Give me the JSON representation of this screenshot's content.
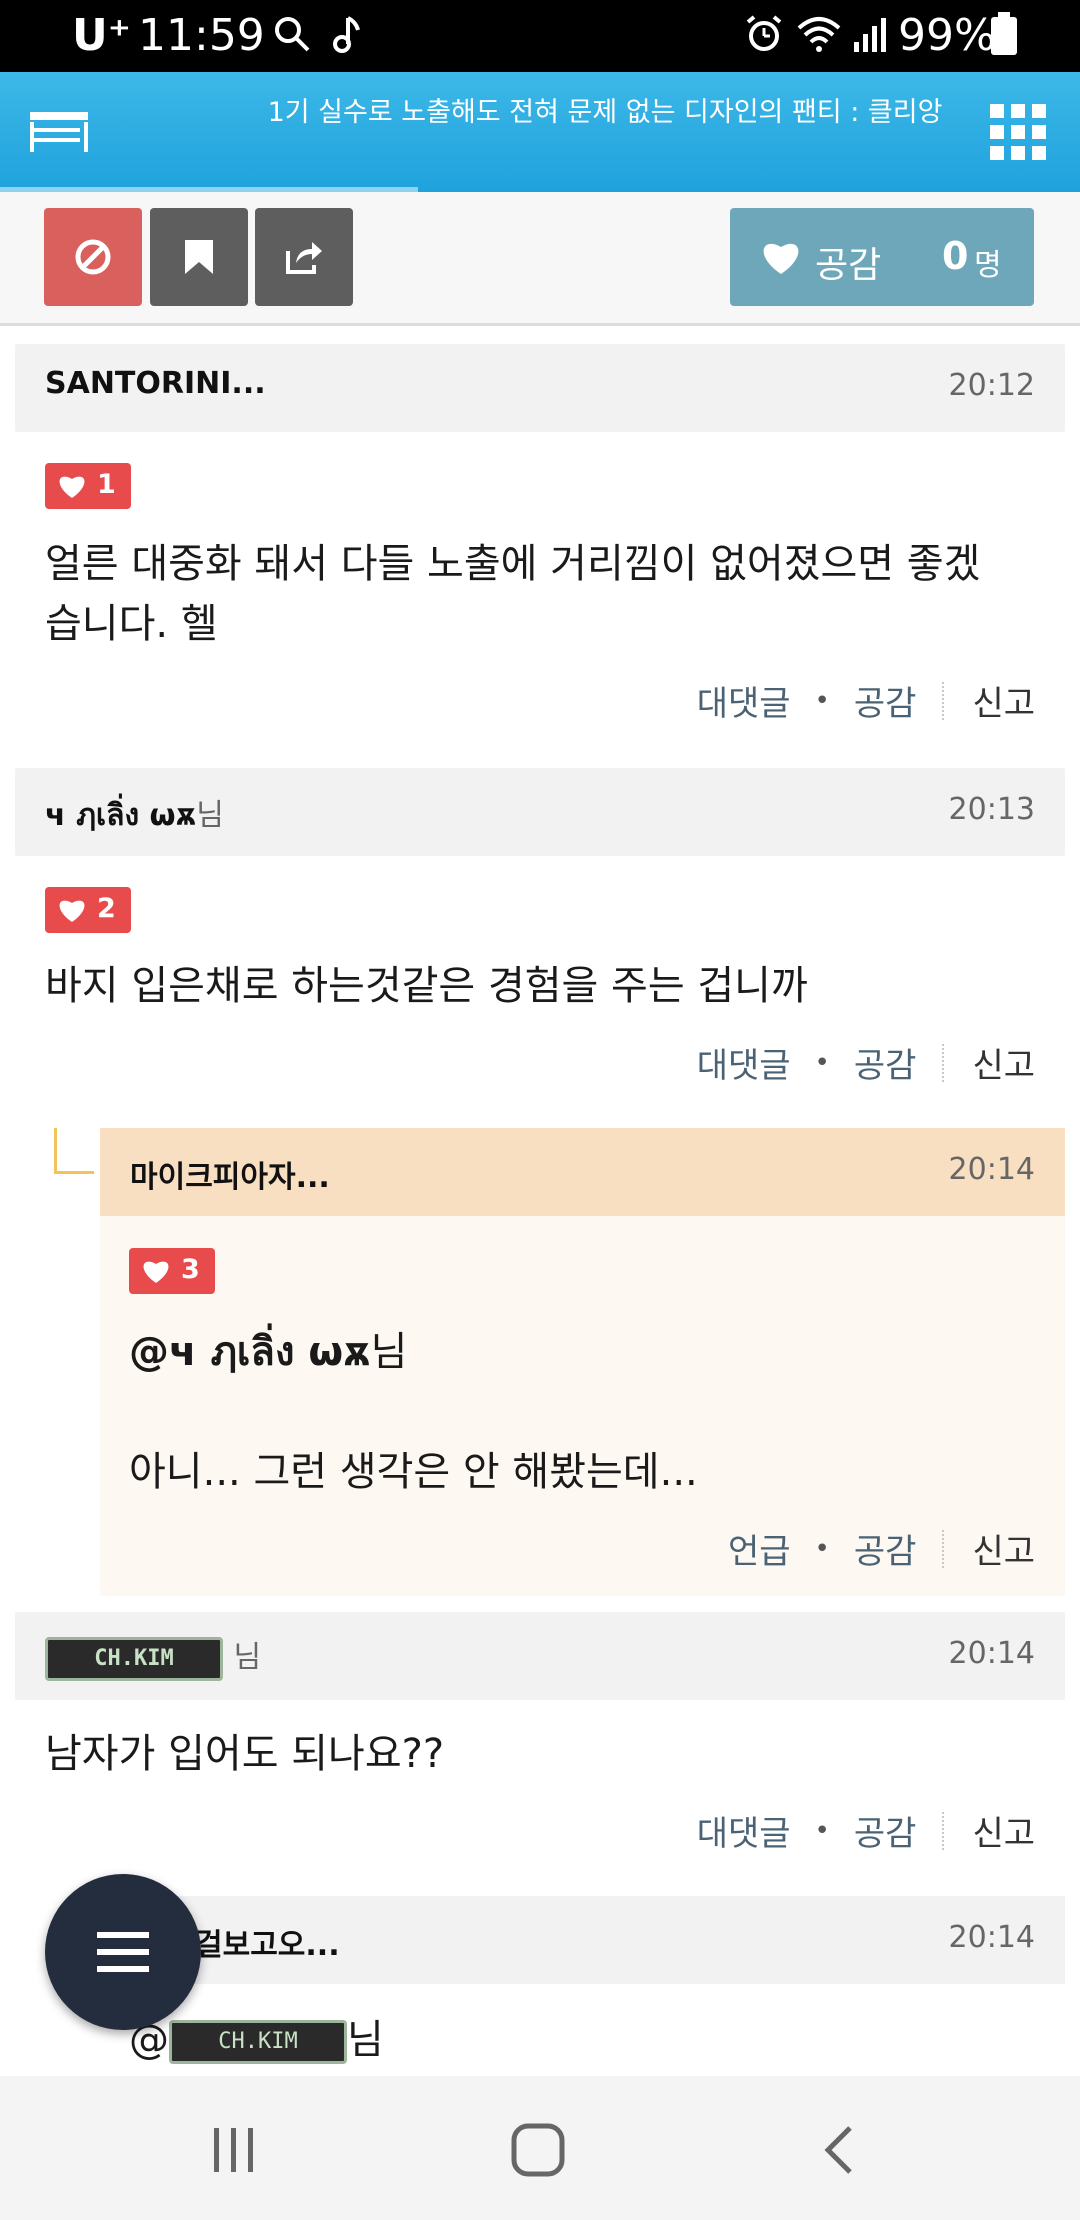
{
  "status_bar": {
    "carrier": "U⁺",
    "time": "11:59",
    "battery": "99%",
    "icons": [
      "search-icon",
      "music-note-icon",
      "alarm-icon",
      "wifi-icon",
      "signal-icon",
      "battery-icon"
    ]
  },
  "header": {
    "title": "1기 실수로 노출해도 전혀 문제 없는 디자인의 팬티 : 클리앙",
    "left_icon": "menu-icon",
    "right_icon": "grid-icon",
    "color": "#2aaae2"
  },
  "toolbar": {
    "like_label": "공감",
    "like_count": "0",
    "like_unit": "명"
  },
  "comments": [
    {
      "author": "SANTORINI...",
      "time": "20:12",
      "likes": "1",
      "text_lines": [
        "얼른 대중화 돼서 다들 노출에 거리낌이 없어졌으면 좋겠",
        "습니다. 헬"
      ],
      "actions": [
        "대댓글",
        "공감",
        "신고"
      ]
    },
    {
      "author": "ч ฦเลิ่ง ѡѫ",
      "author_suffix": "님",
      "time": "20:13",
      "likes": "2",
      "text": "바지 입은채로 하는것같은 경험을 주는 겁니까",
      "actions": [
        "대댓글",
        "공감",
        "신고"
      ]
    },
    {
      "author": "CH.KIM",
      "author_suffix": "님",
      "time": "20:14",
      "text": "남자가 입어도 되나요??",
      "actions": [
        "대댓글",
        "공감",
        "신고"
      ]
    }
  ],
  "reply": {
    "author": "마이크피아자...",
    "time": "20:14",
    "likes": "3",
    "mention": "@ч ฦเลิ่ง ѡѫ",
    "mention_suffix": "님",
    "text": "아니... 그런 생각은 안 해봤는데...",
    "actions": [
      "언급",
      "공감",
      "신고"
    ]
  },
  "partial_reply": {
    "author": "걸보고오...",
    "time": "20:14",
    "mention_prefix": "@",
    "mention_badge": "CH.KIM",
    "mention_suffix": "님"
  },
  "colors": {
    "block_button": "#d9605c",
    "dark_button": "#5e5e5e",
    "like_button": "#6fa7ba",
    "like_badge": "#e84b4b",
    "reply_header": "#f9dfc2",
    "fab": "#242d3d"
  }
}
